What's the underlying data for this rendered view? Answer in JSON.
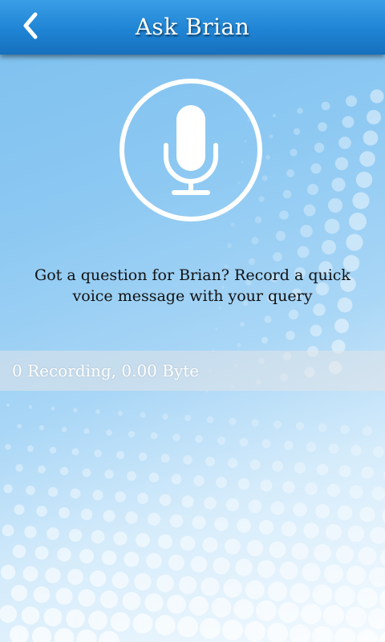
{
  "header": {
    "title": "Ask Brian",
    "back_icon": "chevron-left-icon"
  },
  "record": {
    "icon": "microphone-icon"
  },
  "prompt": {
    "line1": "Got a question for Brian? Record a quick",
    "line2": "voice message with your query"
  },
  "status": {
    "text": "0 Recording, 0.00 Byte"
  },
  "colors": {
    "header": "#1f84d4",
    "background": "#8cc8f2",
    "icon": "#ffffff"
  }
}
